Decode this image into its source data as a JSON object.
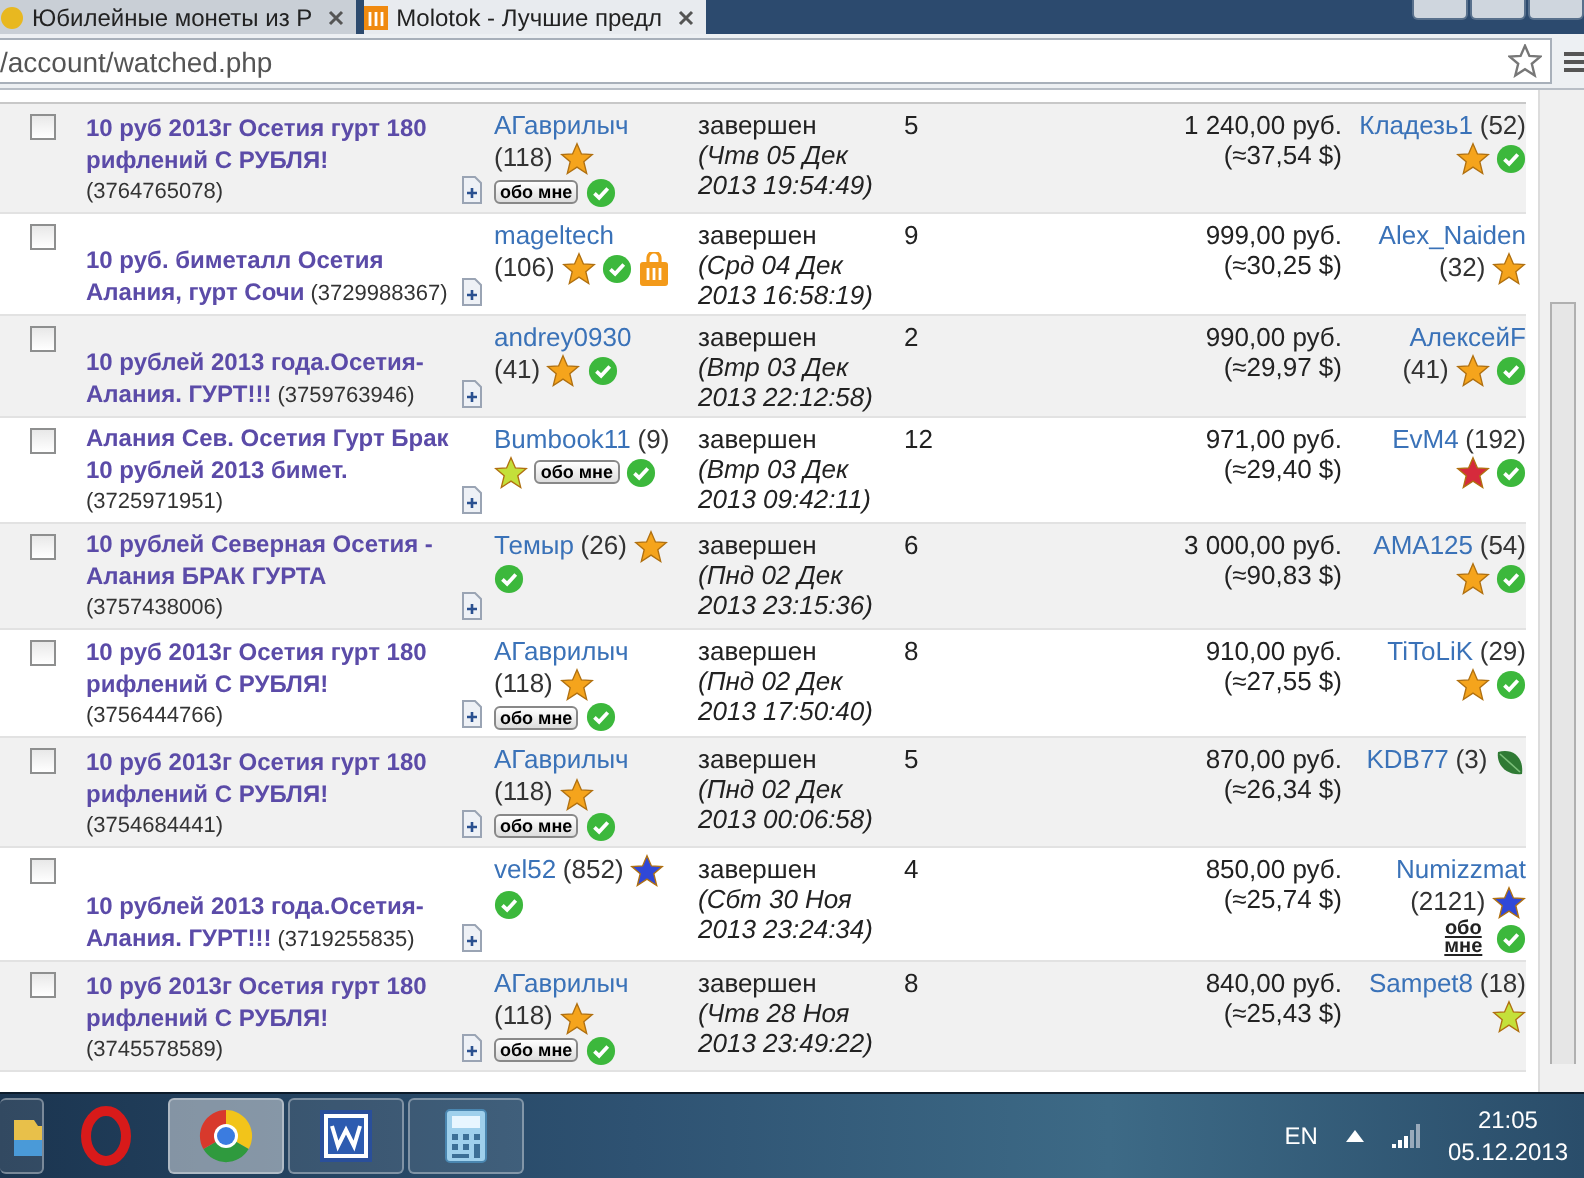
{
  "browser": {
    "tabs": [
      {
        "title": "Юбилейные монеты из Р",
        "selected": false
      },
      {
        "title": "Molotok - Лучшие предл",
        "selected": true
      }
    ],
    "address": "/account/watched.php"
  },
  "lots": [
    {
      "checked": false,
      "title": "**10 руб 2013г Осетия гурт 180 рифлений С РУБЛЯ!** (3764765078)",
      "seller": {
        "name": "АГаврилыч",
        "rating": "(118)",
        "badges": [
          {
            "kind": "star",
            "color": "#f5a41c"
          },
          {
            "kind": "about",
            "label": "обо мне"
          },
          {
            "kind": "check"
          }
        ]
      },
      "status": "завершен",
      "ended": "(Чтв 05 Дек 2013 19:54:49)",
      "bids": "5",
      "price": "1 240,00 руб.",
      "price_usd": "(≈37,54 $)",
      "buyer": {
        "name": "Кладезь1",
        "rating": "(52)",
        "badges": [
          {
            "kind": "star",
            "color": "#f5a41c"
          },
          {
            "kind": "check"
          }
        ]
      }
    },
    {
      "checked": false,
      "title": "**10 руб. биметалл Осетия Алания, гурт Сочи** (3729988367)",
      "seller": {
        "name": "mageltech",
        "rating": "(106)",
        "badges": [
          {
            "kind": "star",
            "color": "#f5a41c"
          },
          {
            "kind": "check"
          },
          {
            "kind": "shop"
          }
        ]
      },
      "status": "завершен",
      "ended": "(Срд 04 Дек 2013 16:58:19)",
      "bids": "9",
      "price": "999,00 руб.",
      "price_usd": "(≈30,25 $)",
      "buyer": {
        "name": "Alex_Naiden",
        "rating": "(32)",
        "badges": [
          {
            "kind": "star",
            "color": "#f5a41c"
          }
        ]
      }
    },
    {
      "checked": false,
      "title": "**10 рублей 2013 года.Осетия-Алания. ГУРТ!!!** (3759763946)",
      "seller": {
        "name": "andrey0930",
        "rating": "(41)",
        "badges": [
          {
            "kind": "star",
            "color": "#f5a41c"
          },
          {
            "kind": "check"
          }
        ]
      },
      "status": "завершен",
      "ended": "(Втр 03 Дек 2013 22:12:58)",
      "bids": "2",
      "price": "990,00 руб.",
      "price_usd": "(≈29,97 $)",
      "buyer": {
        "name": "АлексейF",
        "rating": "(41)",
        "badges": [
          {
            "kind": "star",
            "color": "#f5a41c"
          },
          {
            "kind": "check"
          }
        ]
      }
    },
    {
      "checked": false,
      "title": "**Алания Сев. Осетия Гурт Брак 10 рублей 2013 бимет.** (3725971951)",
      "seller": {
        "name": "Bumbook11",
        "rating": "(9)",
        "badges": [
          {
            "kind": "star",
            "color": "#c4e03a"
          },
          {
            "kind": "about",
            "label": "обо мне"
          },
          {
            "kind": "check"
          }
        ]
      },
      "status": "завершен",
      "ended": "(Втр 03 Дек 2013 09:42:11)",
      "bids": "12",
      "price": "971,00 руб.",
      "price_usd": "(≈29,40 $)",
      "buyer": {
        "name": "EvM4",
        "rating": "(192)",
        "badges": [
          {
            "kind": "star",
            "color": "#d62a3c"
          },
          {
            "kind": "check"
          }
        ]
      }
    },
    {
      "checked": false,
      "title": "**10 рублей Северная Осетия - Алания БРАК ГУРТА** (3757438006)",
      "seller": {
        "name": "Темыр",
        "rating": "(26)",
        "badges": [
          {
            "kind": "star",
            "color": "#f5a41c"
          },
          {
            "kind": "check"
          }
        ]
      },
      "status": "завершен",
      "ended": "(Пнд 02 Дек 2013 23:15:36)",
      "bids": "6",
      "price": "3 000,00 руб.",
      "price_usd": "(≈90,83 $)",
      "buyer": {
        "name": "AMA125",
        "rating": "(54)",
        "badges": [
          {
            "kind": "star",
            "color": "#f5a41c"
          },
          {
            "kind": "check"
          }
        ]
      }
    },
    {
      "checked": false,
      "title": "**10 руб 2013г Осетия гурт 180 рифлений С РУБЛЯ!** (3756444766)",
      "seller": {
        "name": "АГаврилыч",
        "rating": "(118)",
        "badges": [
          {
            "kind": "star",
            "color": "#f5a41c"
          },
          {
            "kind": "about",
            "label": "обо мне"
          },
          {
            "kind": "check"
          }
        ]
      },
      "status": "завершен",
      "ended": "(Пнд 02 Дек 2013 17:50:40)",
      "bids": "8",
      "price": "910,00 руб.",
      "price_usd": "(≈27,55 $)",
      "buyer": {
        "name": "TiToLiK",
        "rating": "(29)",
        "badges": [
          {
            "kind": "star",
            "color": "#f5a41c"
          },
          {
            "kind": "check"
          }
        ]
      }
    },
    {
      "checked": false,
      "title": "**10 руб 2013г Осетия гурт 180 рифлений С РУБЛЯ!** (3754684441)",
      "seller": {
        "name": "АГаврилыч",
        "rating": "(118)",
        "badges": [
          {
            "kind": "star",
            "color": "#f5a41c"
          },
          {
            "kind": "about",
            "label": "обо мне"
          },
          {
            "kind": "check"
          }
        ]
      },
      "status": "завершен",
      "ended": "(Пнд 02 Дек 2013 00:06:58)",
      "bids": "5",
      "price": "870,00 руб.",
      "price_usd": "(≈26,34 $)",
      "buyer": {
        "name": "KDB77",
        "rating": "(3)",
        "badges": [
          {
            "kind": "leaf"
          }
        ]
      }
    },
    {
      "checked": false,
      "title": "**10 рублей 2013 года.Осетия-Алания. ГУРТ!!!** (3719255835)",
      "seller": {
        "name": "vel52",
        "rating": "(852)",
        "badges": [
          {
            "kind": "star",
            "color": "#3048d8"
          },
          {
            "kind": "check"
          }
        ]
      },
      "status": "завершен",
      "ended": "(Сбт 30 Ноя 2013 23:24:34)",
      "bids": "4",
      "price": "850,00 руб.",
      "price_usd": "(≈25,74 $)",
      "buyer": {
        "name": "Numizzmat",
        "rating": "(2121)",
        "badges": [
          {
            "kind": "star",
            "color": "#3048d8"
          },
          {
            "kind": "about-link",
            "label": "обо мне"
          },
          {
            "kind": "check"
          }
        ]
      }
    },
    {
      "checked": false,
      "title": "**10 руб 2013г Осетия гурт 180 рифлений С РУБЛЯ!** (3745578589)",
      "seller": {
        "name": "АГаврилыч",
        "rating": "(118)",
        "badges": [
          {
            "kind": "star",
            "color": "#f5a41c"
          },
          {
            "kind": "about",
            "label": "обо мне"
          },
          {
            "kind": "check"
          }
        ]
      },
      "status": "завершен",
      "ended": "(Чтв 28 Ноя 2013 23:49:22)",
      "bids": "8",
      "price": "840,00 руб.",
      "price_usd": "(≈25,43 $)",
      "buyer": {
        "name": "Sampet8",
        "rating": "(18)",
        "badges": [
          {
            "kind": "star",
            "color": "#c4e03a"
          }
        ]
      }
    }
  ],
  "taskbar": {
    "apps": [
      {
        "kind": "folder",
        "running": true,
        "selected": false
      },
      {
        "kind": "opera",
        "running": false,
        "selected": false
      },
      {
        "kind": "chrome",
        "running": true,
        "selected": true
      },
      {
        "kind": "word",
        "running": true,
        "selected": false
      },
      {
        "kind": "calculator",
        "running": true,
        "selected": false
      }
    ],
    "language": "EN",
    "time": "21:05",
    "date": "05.12.2013"
  }
}
